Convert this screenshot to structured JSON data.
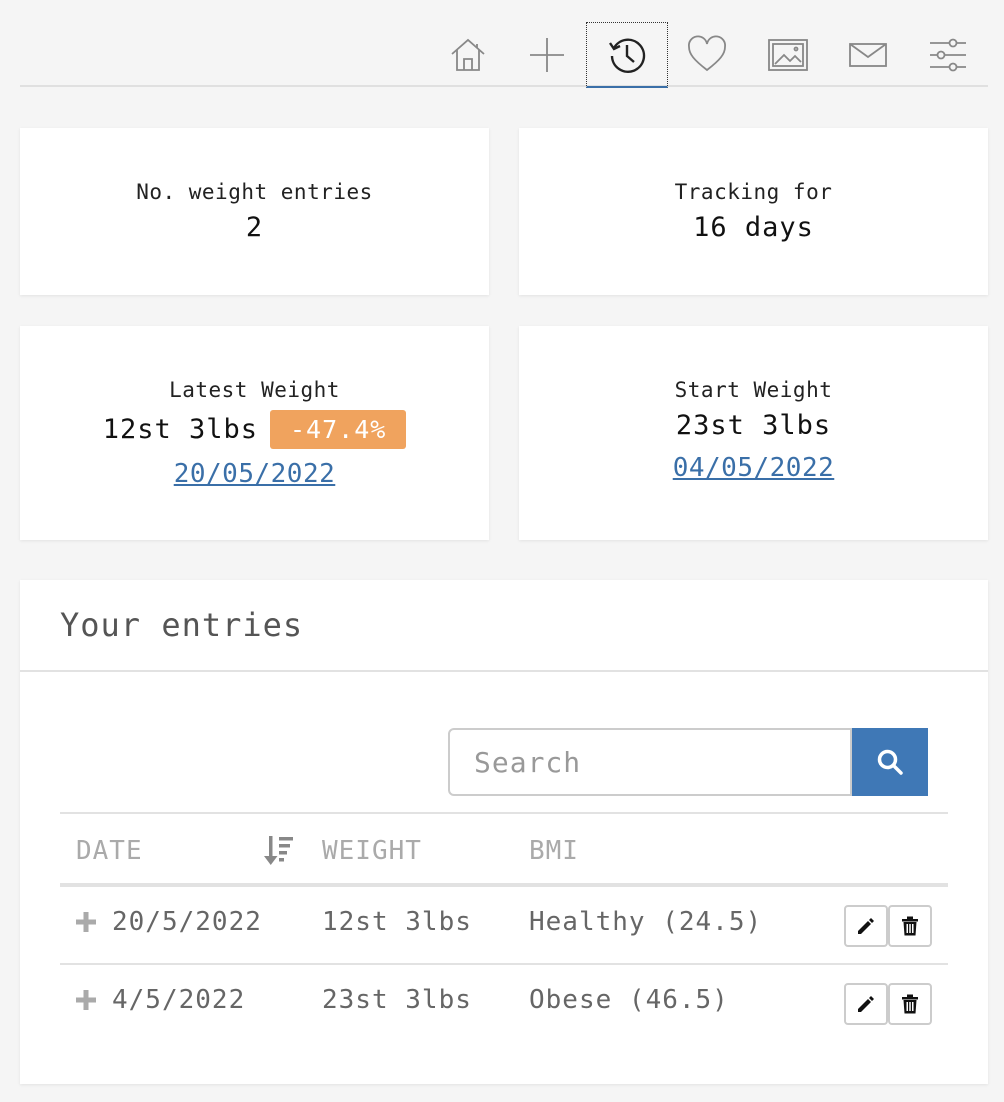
{
  "nav": {
    "items": [
      {
        "icon": "home-icon"
      },
      {
        "icon": "plus-icon"
      },
      {
        "icon": "history-icon",
        "active": true
      },
      {
        "icon": "heart-icon"
      },
      {
        "icon": "image-icon"
      },
      {
        "icon": "mail-icon"
      },
      {
        "icon": "settings-sliders-icon"
      }
    ]
  },
  "stats": {
    "entries": {
      "label": "No. weight entries",
      "value": "2"
    },
    "tracking": {
      "label": "Tracking for",
      "value": "16 days"
    },
    "latest": {
      "label": "Latest Weight",
      "value": "12st 3lbs",
      "badge": "-47.4%",
      "date": "20/05/2022"
    },
    "start": {
      "label": "Start Weight",
      "value": "23st 3lbs",
      "date": "04/05/2022"
    }
  },
  "entries": {
    "title": "Your entries",
    "search_placeholder": "Search",
    "columns": {
      "date": "DATE",
      "weight": "WEIGHT",
      "bmi": "BMI"
    },
    "rows": [
      {
        "date": "20/5/2022",
        "weight": "12st 3lbs",
        "bmi": "Healthy (24.5)"
      },
      {
        "date": "4/5/2022",
        "weight": "23st 3lbs",
        "bmi": "Obese (46.5)"
      }
    ]
  },
  "colors": {
    "accent": "#3f78b6",
    "badge": "#f0a35e",
    "link": "#3a6fa8"
  }
}
